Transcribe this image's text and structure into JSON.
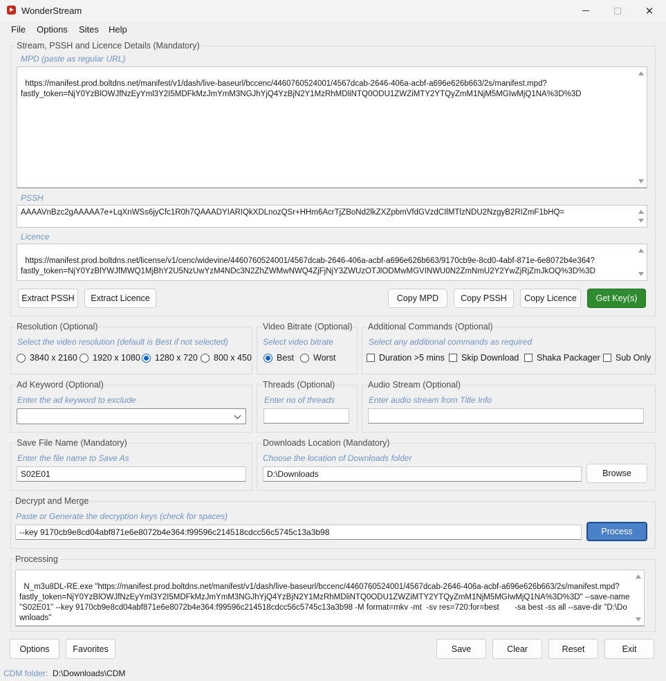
{
  "window": {
    "title": "WonderStream"
  },
  "menu": {
    "items": [
      "File",
      "Options",
      "Sites",
      "Help"
    ]
  },
  "stream_group": {
    "title": "Stream, PSSH and Licence Details (Mandatory)",
    "mpd_hint": "MPD (paste as regular URL)",
    "mpd_value": "https://manifest.prod.boltdns.net/manifest/v1/dash/live-baseurl/bccenc/4460760524001/4567dcab-2646-406a-acbf-a696e626b663/2s/manifest.mpd?\nfastly_token=NjY0YzBlOWJfNzEyYml3Y2I5MDFkMzJmYmM3NGJhYjQ4YzBjN2Y1MzRhMDliNTQ0ODU1ZWZiMTY2YTQyZmM1NjM5MGIwMjQ1NA%3D%3D",
    "pssh_hint": "PSSH",
    "pssh_value": "AAAAVnBzc2gAAAAA7e+LqXnWSs6jyCfc1R0h7QAAADYIARIQkXDLnozQSr+HHm6AcrTjZBoNd2lkZXZpbmVfdGVzdCIlMTlzNDU2NzgyB2RIZmF1bHQ=",
    "licence_hint": "Licence",
    "licence_value": "https://manifest.prod.boltdns.net/license/v1/cenc/widevine/4460760524001/4567dcab-2646-406a-acbf-a696e626b663/9170cb9e-8cd0-4abf-871e-6e8072b4e364?\nfastly_token=NjY0YzBlYWJfMWQ1MjBhY2U5NzUwYzM4NDc3N2ZhZWMwNWQ4ZjFjNjY3ZWUzOTJlODMwMGVINWU0N2ZmNmU2Y2YwZjRjZmJkOQ%3D%3D",
    "buttons": {
      "extract_pssh": "Extract PSSH",
      "extract_licence": "Extract Licence",
      "copy_mpd": "Copy MPD",
      "copy_pssh": "Copy PSSH",
      "copy_licence": "Copy Licence",
      "get_keys": "Get Key(s)"
    }
  },
  "resolution": {
    "title": "Resolution (Optional)",
    "hint": "Select the video resolution (default is Best if not selected)",
    "options": [
      "3840 x 2160",
      "1920 x 1080",
      "1280 x 720",
      "800 x 450"
    ],
    "selected": "1280 x 720"
  },
  "bitrate": {
    "title": "Video Bitrate (Optional)",
    "hint": "Select video bitrate",
    "options": [
      "Best",
      "Worst"
    ],
    "selected": "Best"
  },
  "additional": {
    "title": "Additional Commands (Optional)",
    "hint": "Select any additional commands as required",
    "options": [
      "Duration >5 mins",
      "Skip Download",
      "Shaka Packager",
      "Sub Only"
    ]
  },
  "ad_keyword": {
    "title": "Ad Keyword (Optional)",
    "hint": "Enter the ad keyword to exclude",
    "value": ""
  },
  "threads": {
    "title": "Threads (Optional)",
    "hint": "Enter no of threads",
    "value": ""
  },
  "audio": {
    "title": "Audio Stream (Optional)",
    "hint": "Enter audio stream from Title Info",
    "value": ""
  },
  "save_name": {
    "title": "Save File Name (Mandatory)",
    "hint": "Enter the file name to Save As",
    "value": "S02E01"
  },
  "downloads": {
    "title": "Downloads Location (Mandatory)",
    "hint": "Choose the location of Downloads folder",
    "value": "D:\\Downloads",
    "browse_label": "Browse"
  },
  "decrypt": {
    "title": "Decrypt and Merge",
    "hint": "Paste or Generate the decryption keys (check for spaces)",
    "value": "--key 9170cb9e8cd04abf871e6e8072b4e364:f99596c214518cdcc56c5745c13a3b98",
    "process_label": "Process"
  },
  "processing": {
    "title": "Processing",
    "value": "N_m3u8DL-RE.exe \"https://manifest.prod.boltdns.net/manifest/v1/dash/live-baseurl/bccenc/4460760524001/4567dcab-2646-406a-acbf-a696e626b663/2s/manifest.mpd?\nfastly_token=NjY0YzBlOWJfNzEyYml3Y2I5MDFkMzJmYmM3NGJhYjQ4YzBjN2Y1MzRhMDliNTQ0ODU1ZWZiMTY2YTQyZmM1NjM5MGIwMjQ1NA%3D%3D\" --save-name \"S02E01\" --key 9170cb9e8cd04abf871e6e8072b4e364:f99596c214518cdcc56c5745c13a3b98 -M format=mkv -mt  -sv res=720:for=best       -sa best -ss all --save-dir \"D:\\Downloads\""
  },
  "bottom_buttons": {
    "options": "Options",
    "favorites": "Favorites",
    "save": "Save",
    "clear": "Clear",
    "reset": "Reset",
    "exit": "Exit"
  },
  "status": {
    "label": "CDM folder:",
    "value": "D:\\Downloads\\CDM"
  },
  "colors": {
    "accent_hint": "#6e94c9",
    "get_keys_green": "#2e8b2e",
    "process_blue": "#4a80c8",
    "app_icon_red": "#c42b1c"
  }
}
